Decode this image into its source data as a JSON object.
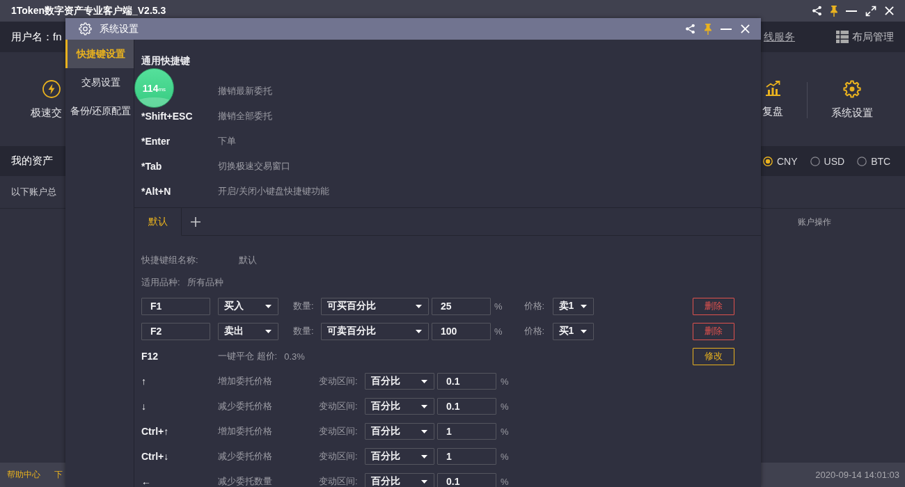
{
  "app": {
    "title": "1Token数字资产专业客户端_V2.5.3"
  },
  "header": {
    "username": "用户名：fn",
    "link": "线服务",
    "layout_button": "布局管理"
  },
  "toolbar": {
    "left": [
      {
        "kind": "lightning",
        "label": "极速交"
      }
    ],
    "right": [
      {
        "kind": "chart",
        "label": "复盘"
      },
      {
        "kind": "gear",
        "label": "系统设置"
      }
    ]
  },
  "assets": {
    "title": "我的资产",
    "currencies": [
      {
        "label": "CNY",
        "selected": true
      },
      {
        "label": "USD",
        "selected": false
      },
      {
        "label": "BTC",
        "selected": false
      }
    ],
    "summary": "以下账户总"
  },
  "table": {
    "columns": [
      "账户操作"
    ]
  },
  "status_bar": {
    "links": [
      "帮助中心",
      "下"
    ],
    "timestamp": "2020-09-14 14:01:03"
  },
  "dialog": {
    "title": "系统设置",
    "sidebar": [
      {
        "label": "快捷键设置",
        "selected": true
      },
      {
        "label": "交易设置",
        "selected": false
      },
      {
        "label": "备份/还原配置",
        "selected": false
      }
    ],
    "section_title": "通用快捷键",
    "general_shortcuts": [
      {
        "action": "撤销最新委托"
      },
      {
        "key": "*Shift+ESC",
        "action": "撤销全部委托"
      },
      {
        "key": "*Enter",
        "action": "下单"
      },
      {
        "key": "*Tab",
        "action": "切换极速交易窗口"
      },
      {
        "key": "*Alt+N",
        "action": "开启/关闭小键盘快捷键功能"
      }
    ],
    "groups": [
      {
        "label": "默认",
        "selected": true
      }
    ],
    "group_name": {
      "label": "快捷键组名称:",
      "value": "默认"
    },
    "scope": {
      "label": "适用品种:",
      "value": "所有品种"
    },
    "order_shortcuts": [
      {
        "key": "F1",
        "side": "买入",
        "qty_label": "数量:",
        "qty_mode": "可买百分比",
        "qty_value": "25",
        "unit": "%",
        "price_label": "价格:",
        "price": "卖1",
        "button": "删除"
      },
      {
        "key": "F2",
        "side": "卖出",
        "qty_label": "数量:",
        "qty_mode": "可卖百分比",
        "qty_value": "100",
        "unit": "%",
        "price_label": "价格:",
        "price": "买1",
        "button": "删除"
      }
    ],
    "close_shortcut": {
      "key": "F12",
      "text": "一键平仓 超价:",
      "value": "0.3%",
      "button": "修改"
    },
    "adjust_shortcuts": [
      {
        "key": "↑",
        "action": "增加委托价格",
        "label": "变动区间:",
        "mode": "百分比",
        "value": "0.1",
        "unit": "%"
      },
      {
        "key": "↓",
        "action": "减少委托价格",
        "label": "变动区间:",
        "mode": "百分比",
        "value": "0.1",
        "unit": "%"
      },
      {
        "key": "Ctrl+↑",
        "action": "增加委托价格",
        "label": "变动区间:",
        "mode": "百分比",
        "value": "1",
        "unit": "%"
      },
      {
        "key": "Ctrl+↓",
        "action": "减少委托价格",
        "label": "变动区间:",
        "mode": "百分比",
        "value": "1",
        "unit": "%"
      },
      {
        "key": "←",
        "action": "减少委托数量",
        "label": "变动区间:",
        "mode": "百分比",
        "value": "0.1",
        "unit": "%"
      }
    ]
  },
  "latency_badge": {
    "value": "114",
    "unit": "ms"
  }
}
